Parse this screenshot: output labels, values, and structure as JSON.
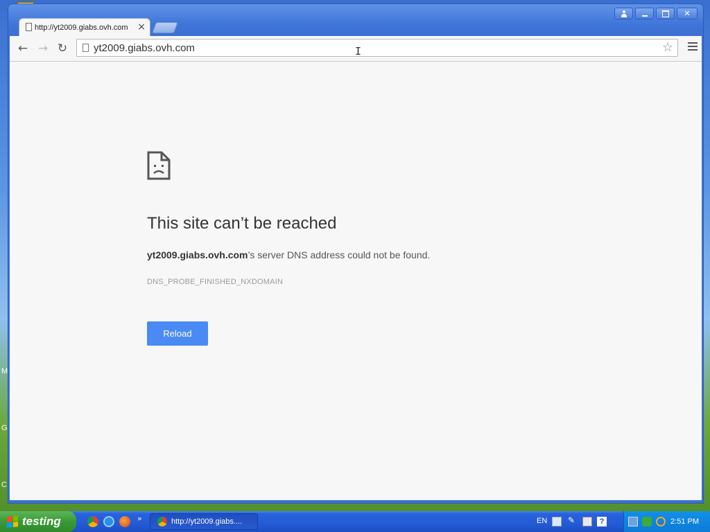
{
  "desktop": {
    "edge_letters": [
      "M",
      "G",
      "C"
    ]
  },
  "browser": {
    "tab": {
      "title": "http://yt2009.giabs.ovh.com",
      "close_glyph": "×"
    },
    "omnibox": {
      "url": "yt2009.giabs.ovh.com"
    },
    "window_controls": {
      "close_glyph": "✕"
    }
  },
  "error_page": {
    "title": "This site can’t be reached",
    "message_host": "yt2009.giabs.ovh.com",
    "message_rest": "’s server DNS address could not be found.",
    "error_code": "DNS_PROBE_FINISHED_NXDOMAIN",
    "reload_label": "Reload"
  },
  "taskbar": {
    "start_label": "testing",
    "quick_launch_more": "»",
    "task_item_label": "http://yt2009.giabs....",
    "language": "EN",
    "clock": "2:51 PM"
  },
  "colors": {
    "reload_button": "#4a8af4",
    "xp_blue": "#245bd6",
    "start_green": "#3a9a36"
  }
}
